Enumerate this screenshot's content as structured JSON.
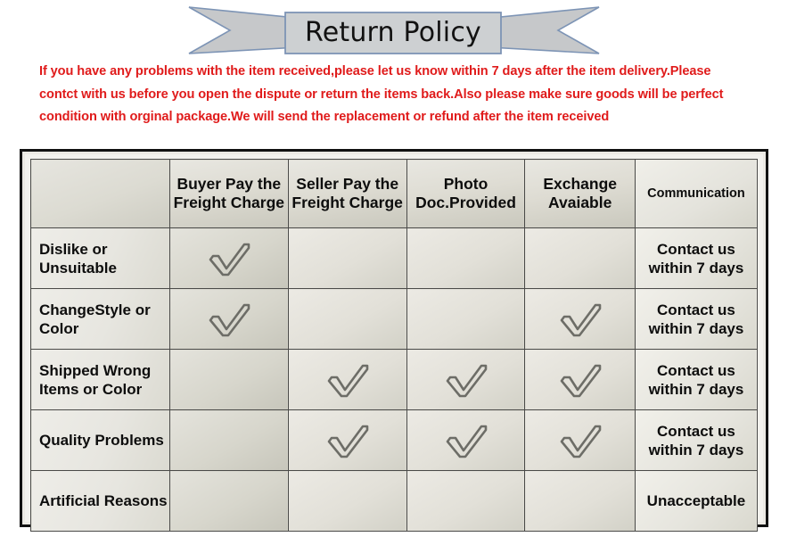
{
  "banner": {
    "title": "Return Policy",
    "ribbon_fill": "#c6c8ca",
    "ribbon_stroke": "#7d94b5",
    "plate_fill": "#cdd0d2"
  },
  "policy_note": {
    "color": "#e01b1b",
    "text": "If you  have any problems with the item received,please let us know within 7 days after the item delivery.Please contct with us before you open the dispute or return the items back.Also please make sure goods will be perfect condition with orginal package.We will send the replacement or refund after the item received"
  },
  "table": {
    "columns": [
      {
        "key": "reason",
        "label": ""
      },
      {
        "key": "buyer",
        "label": "Buyer Pay the Freight Charge"
      },
      {
        "key": "seller",
        "label": "Seller Pay the Freight Charge"
      },
      {
        "key": "photo",
        "label": "Photo Doc.Provided"
      },
      {
        "key": "exchange",
        "label": "Exchange Avaiable"
      },
      {
        "key": "comm",
        "label": "Communication"
      }
    ],
    "check_icon": "check-mark-icon",
    "check_color": "#6d6d67",
    "rows": [
      {
        "label": "Dislike or Unsuitable",
        "buyer": true,
        "seller": false,
        "photo": false,
        "exchange": false,
        "comm": "Contact us within 7 days"
      },
      {
        "label": "ChangeStyle or Color",
        "buyer": true,
        "seller": false,
        "photo": false,
        "exchange": true,
        "comm": "Contact us within 7 days"
      },
      {
        "label": "Shipped Wrong Items or Color",
        "buyer": false,
        "seller": true,
        "photo": true,
        "exchange": true,
        "comm": "Contact us within 7 days"
      },
      {
        "label": "Quality Problems",
        "buyer": false,
        "seller": true,
        "photo": true,
        "exchange": true,
        "comm": "Contact us within 7 days"
      },
      {
        "label": "Artificial Reasons",
        "buyer": false,
        "seller": false,
        "photo": false,
        "exchange": false,
        "comm": "Unacceptable"
      }
    ]
  }
}
